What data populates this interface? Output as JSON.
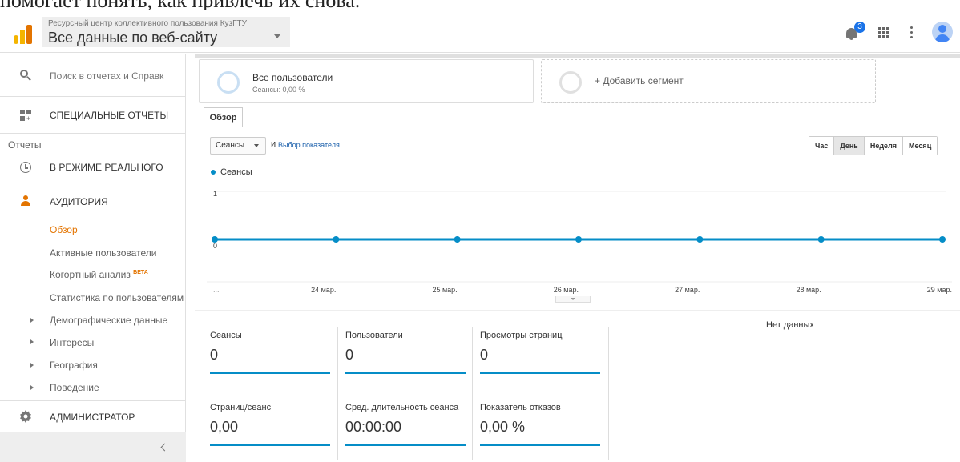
{
  "overlay_text": "помогает понять, как привлечь их снова.",
  "header": {
    "org_name": "Ресурсный центр коллективного пользования КузГТУ",
    "property_name": "Все данные по веб-сайту",
    "notification_count": "3"
  },
  "sidebar": {
    "search_placeholder": "Поиск в отчетах и Справк",
    "custom_reports": "СПЕЦИАЛЬНЫЕ ОТЧЕТЫ",
    "reports_label": "Отчеты",
    "realtime": "В РЕЖИМЕ РЕАЛЬНОГО",
    "audience": "АУДИТОРИЯ",
    "audience_items": [
      "Обзор",
      "Активные пользователи",
      "Когортный анализ",
      "Статистика по пользователям"
    ],
    "beta": "БЕТА",
    "expandable_items": [
      "Демографические данные",
      "Интересы",
      "География",
      "Поведение"
    ],
    "admin": "АДМИНИСТРАТОР"
  },
  "segments": {
    "current_title": "Все пользователи",
    "current_sub": "Сеансы: 0,00 %",
    "add_label": "+ Добавить сегмент"
  },
  "tab": "Обзор",
  "controls": {
    "metric": "Сеансы",
    "and": "и",
    "choose_metric": "Выбор показателя",
    "granularity": [
      "Час",
      "День",
      "Неделя",
      "Месяц"
    ],
    "granularity_selected": "День"
  },
  "chart_data": {
    "type": "line",
    "series": [
      {
        "name": "Сеансы",
        "values": [
          0,
          0,
          0,
          0,
          0,
          0,
          0
        ]
      }
    ],
    "x": [
      "...",
      "24 мар.",
      "25 мар.",
      "26 мар.",
      "27 мар.",
      "28 мар.",
      "29 мар."
    ],
    "ylim": [
      0,
      1
    ],
    "yticks": [
      "0",
      "1"
    ],
    "color": "#058dc7"
  },
  "scorecards": [
    {
      "label": "Сеансы",
      "value": "0"
    },
    {
      "label": "Пользователи",
      "value": "0"
    },
    {
      "label": "Просмотры страниц",
      "value": "0"
    },
    {
      "label": "Страниц/сеанс",
      "value": "0,00"
    },
    {
      "label": "Сред. длительность сеанса",
      "value": "00:00:00"
    },
    {
      "label": "Показатель отказов",
      "value": "0,00 %"
    }
  ],
  "no_data": "Нет данных"
}
